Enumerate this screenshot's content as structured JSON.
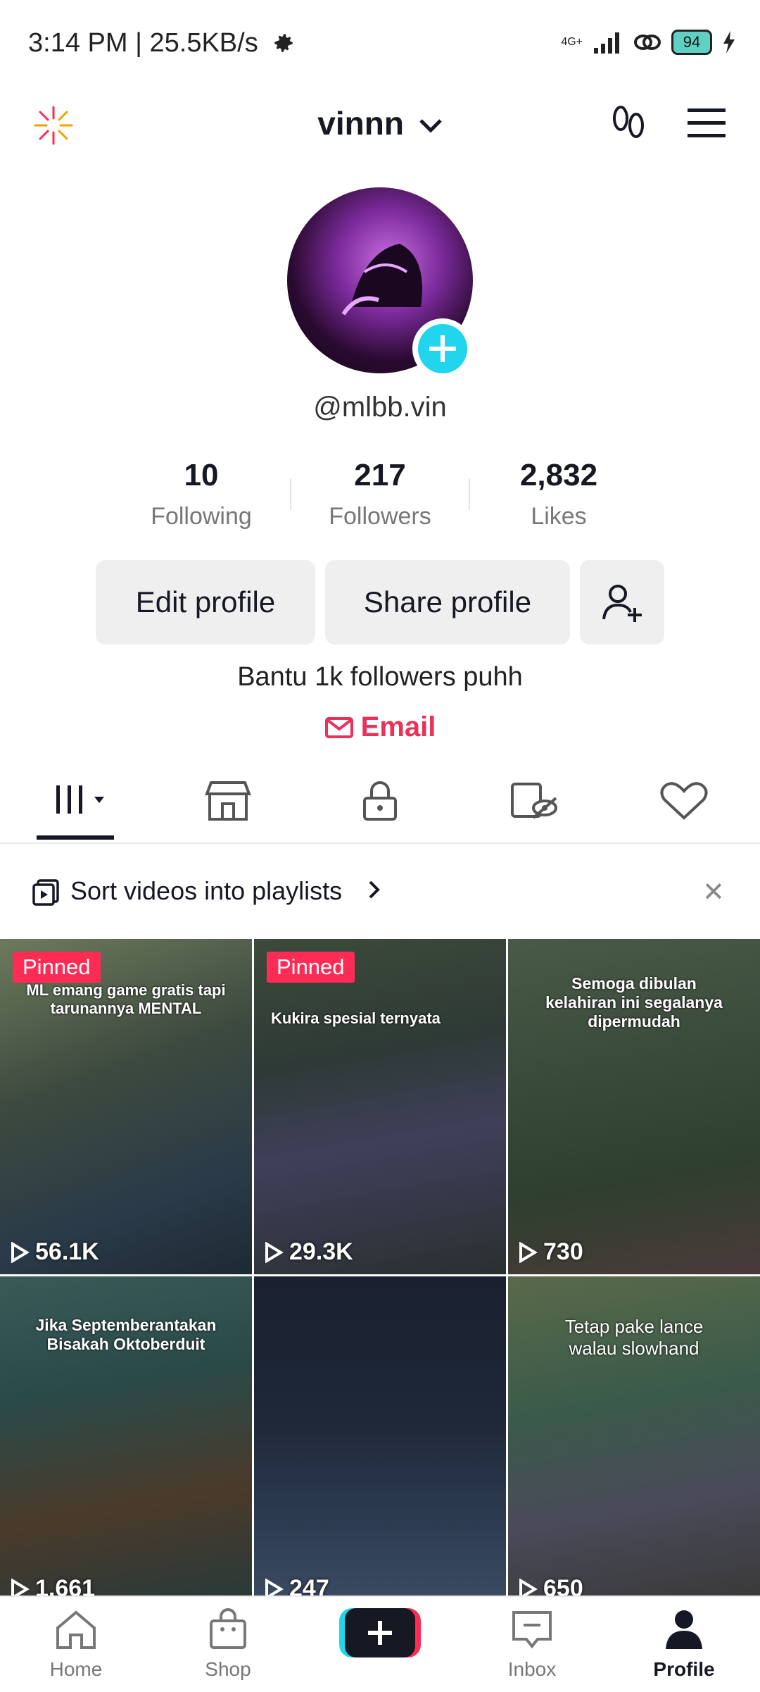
{
  "status_bar": {
    "time": "3:14 PM | 25.5KB/s",
    "battery": "94",
    "network": "4G+"
  },
  "header": {
    "username": "vinnn"
  },
  "profile": {
    "handle": "@mlbb.vin",
    "bio": "Bantu 1k followers puhh",
    "email_label": "Email"
  },
  "stats": [
    {
      "value": "10",
      "label": "Following"
    },
    {
      "value": "217",
      "label": "Followers"
    },
    {
      "value": "2,832",
      "label": "Likes"
    }
  ],
  "buttons": {
    "edit": "Edit profile",
    "share": "Share profile"
  },
  "playlist_banner": {
    "text": "Sort videos into playlists"
  },
  "videos": [
    {
      "views": "56.1K",
      "pinned": "Pinned",
      "caption": "ML emang game gratis tapi tarunannya MENTAL"
    },
    {
      "views": "29.3K",
      "pinned": "Pinned",
      "caption": "Kukira spesial ternyata"
    },
    {
      "views": "730",
      "pinned": "",
      "caption": "Semoga dibulan kelahiran ini segalanya dipermudah"
    },
    {
      "views": "1,661",
      "pinned": "",
      "caption": "Jika Septemberantakan Bisakah Oktoberduit"
    },
    {
      "views": "247",
      "pinned": "",
      "caption": ""
    },
    {
      "views": "650",
      "pinned": "",
      "caption": "Tetap pake lance walau slowhand"
    }
  ],
  "nav": {
    "home": "Home",
    "shop": "Shop",
    "inbox": "Inbox",
    "profile": "Profile"
  },
  "colors": {
    "accent": "#fe2c55",
    "email": "#e8325a",
    "cyan": "#20d5ec"
  }
}
